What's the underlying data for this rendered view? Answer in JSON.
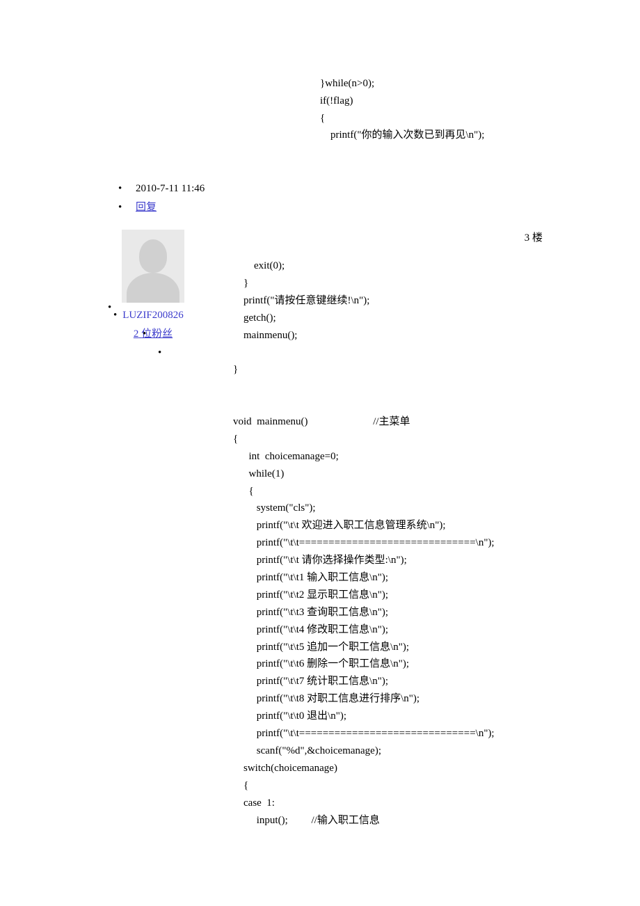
{
  "top_code": "}while(n>0);\nif(!flag)\n{\n    printf(\"你的输入次数已到再见\\n\");",
  "meta": {
    "timestamp": "2010-7-11  11:46",
    "reply": "回复"
  },
  "user": {
    "name": "LUZIF200826",
    "fans_count": "2",
    "fans_label": "位粉丝"
  },
  "floor": "3 楼",
  "code_block": "        exit(0);\n    }\n    printf(\"请按任意键继续!\\n\");\n    getch();\n    mainmenu();\n\n}\n\n\nvoid  mainmenu()                         //主菜单\n{\n      int  choicemanage=0;\n      while(1)\n      {\n         system(\"cls\");\n         printf(\"\\t\\t 欢迎进入职工信息管理系统\\n\");\n         printf(\"\\t\\t==============================\\n\");\n         printf(\"\\t\\t 请你选择操作类型:\\n\");\n         printf(\"\\t\\t1 输入职工信息\\n\");\n         printf(\"\\t\\t2 显示职工信息\\n\");\n         printf(\"\\t\\t3 查询职工信息\\n\");\n         printf(\"\\t\\t4 修改职工信息\\n\");\n         printf(\"\\t\\t5 追加一个职工信息\\n\");\n         printf(\"\\t\\t6 删除一个职工信息\\n\");\n         printf(\"\\t\\t7 统计职工信息\\n\");\n         printf(\"\\t\\t8 对职工信息进行排序\\n\");\n         printf(\"\\t\\t0 退出\\n\");\n         printf(\"\\t\\t==============================\\n\");\n         scanf(\"%d\",&choicemanage);\n    switch(choicemanage)\n    {\n    case  1:\n         input();         //输入职工信息"
}
